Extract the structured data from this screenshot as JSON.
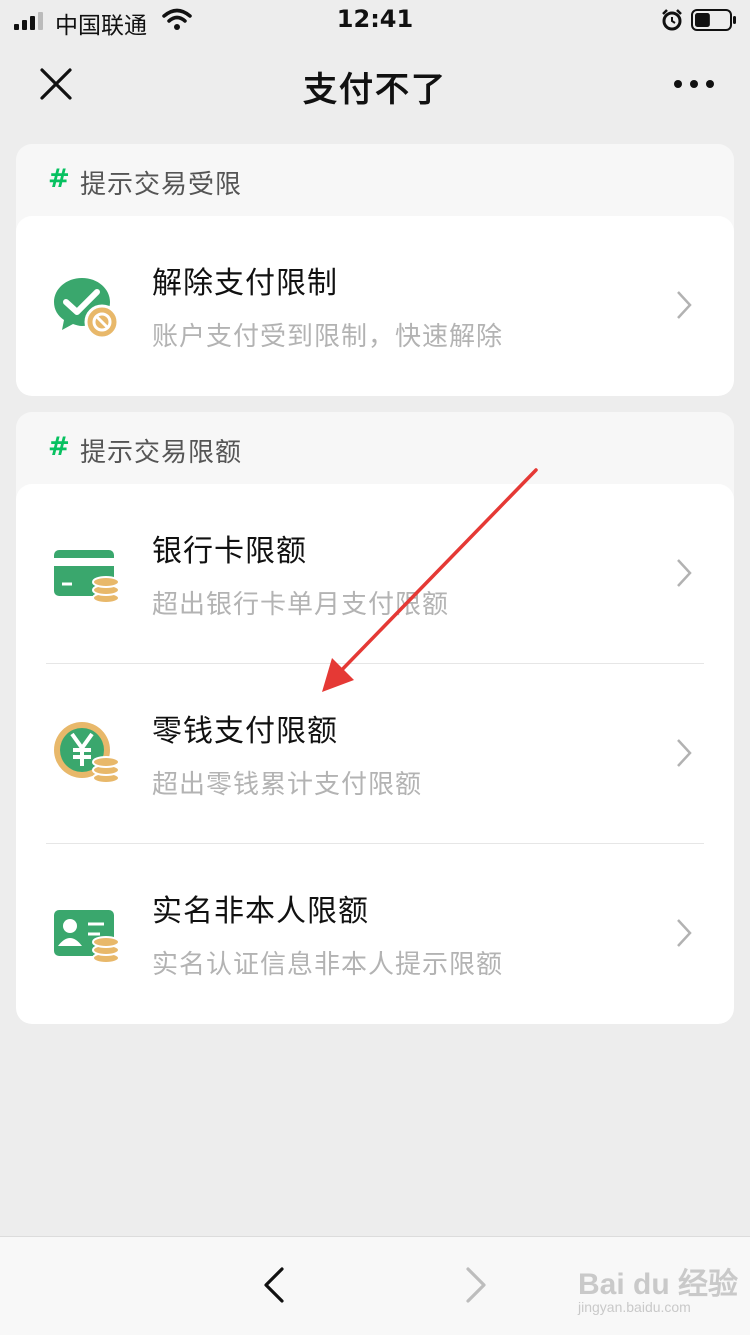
{
  "status_bar": {
    "carrier": "中国联通",
    "time": "12:41",
    "battery_level": 0.45
  },
  "nav": {
    "title": "支付不了",
    "close_icon": "close-icon",
    "more_icon": "more-icon"
  },
  "sections": [
    {
      "hash": "#",
      "title": "提示交易受限",
      "items": [
        {
          "title": "解除支付限制",
          "desc": "账户支付受到限制，快速解除",
          "icon": "wechat-pay-blocked-icon"
        }
      ]
    },
    {
      "hash": "#",
      "title": "提示交易限额",
      "items": [
        {
          "title": "银行卡限额",
          "desc": "超出银行卡单月支付限额",
          "icon": "bank-card-coins-icon"
        },
        {
          "title": "零钱支付限额",
          "desc": "超出零钱累计支付限额",
          "icon": "yuan-coins-icon"
        },
        {
          "title": "实名非本人限额",
          "desc": "实名认证信息非本人提示限额",
          "icon": "id-card-coins-icon"
        }
      ]
    }
  ],
  "toolbar": {
    "back_icon": "chevron-left-icon",
    "forward_icon": "chevron-right-icon"
  },
  "watermark": {
    "text": "Bai du 经验",
    "sub": "jingyan.baidu.com"
  },
  "colors": {
    "accent": "#07c160",
    "coin": "#e8b86a",
    "annotation": "#e53935"
  }
}
